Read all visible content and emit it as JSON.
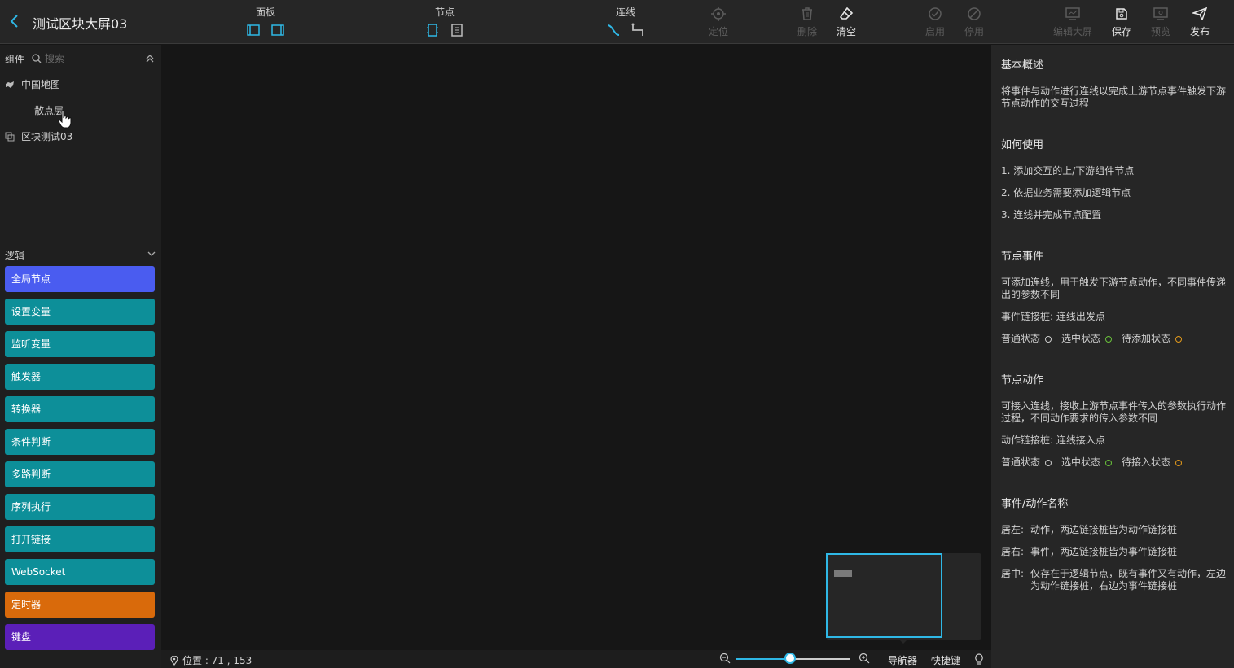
{
  "header": {
    "title": "测试区块大屏03",
    "groups": {
      "panel": "面板",
      "node": "节点",
      "line": "连线"
    },
    "buttons": {
      "locate": "定位",
      "delete": "删除",
      "clear": "清空",
      "enable": "启用",
      "disable": "停用",
      "edit_screen": "编辑大屏",
      "save": "保存",
      "preview": "预览",
      "publish": "发布"
    }
  },
  "left": {
    "components_title": "组件",
    "search_placeholder": "搜索",
    "tree": [
      {
        "label": "中国地图"
      },
      {
        "label": "散点层"
      },
      {
        "label": "区块测试03"
      }
    ],
    "logic_title": "逻辑",
    "logic_items": [
      {
        "label": "全局节点",
        "color": "#4a5cf0"
      },
      {
        "label": "设置变量",
        "color": "#0d8f99"
      },
      {
        "label": "监听变量",
        "color": "#0d8f99"
      },
      {
        "label": "触发器",
        "color": "#0d8f99"
      },
      {
        "label": "转换器",
        "color": "#0d8f99"
      },
      {
        "label": "条件判断",
        "color": "#0d8f99"
      },
      {
        "label": "多路判断",
        "color": "#0d8f99"
      },
      {
        "label": "序列执行",
        "color": "#0d8f99"
      },
      {
        "label": "打开链接",
        "color": "#0d8f99"
      },
      {
        "label": "WebSocket",
        "color": "#0d8f99"
      },
      {
        "label": "定时器",
        "color": "#d96a0b"
      },
      {
        "label": "键盘",
        "color": "#5b1fb8"
      }
    ]
  },
  "bottom": {
    "position": "位置 : 71 , 153",
    "zoom_level": 0.47,
    "navigator": "导航器",
    "shortcuts": "快捷键"
  },
  "right": {
    "overview_title": "基本概述",
    "overview_text": "将事件与动作进行连线以完成上游节点事件触发下游节点动作的交互过程",
    "howto_title": "如何使用",
    "howto_steps": [
      "1. 添加交互的上/下游组件节点",
      "2. 依据业务需要添加逻辑节点",
      "3. 连线并完成节点配置"
    ],
    "events_title": "节点事件",
    "events_text": "可添加连线，用于触发下游节点动作，不同事件传递出的参数不同",
    "events_anchor": "事件链接桩: 连线出发点",
    "events_states": [
      "普通状态",
      "选中状态",
      "待添加状态"
    ],
    "actions_title": "节点动作",
    "actions_text": "可接入连线，接收上游节点事件传入的参数执行动作过程，不同动作要求的传入参数不同",
    "actions_anchor": "动作链接桩: 连线接入点",
    "actions_states": [
      "普通状态",
      "选中状态",
      "待接入状态"
    ],
    "state_colors": [
      "#cccccc",
      "#6ac23b",
      "#e39a1c"
    ],
    "names_title": "事件/动作名称",
    "names": [
      {
        "k": "居左:",
        "v": "动作，两边链接桩皆为动作链接桩"
      },
      {
        "k": "居右:",
        "v": "事件，两边链接桩皆为事件链接桩"
      },
      {
        "k": "居中:",
        "v": "仅存在于逻辑节点，既有事件又有动作，左边为动作链接桩，右边为事件链接桩"
      }
    ]
  },
  "colors": {
    "accent": "#2fb8e6"
  }
}
